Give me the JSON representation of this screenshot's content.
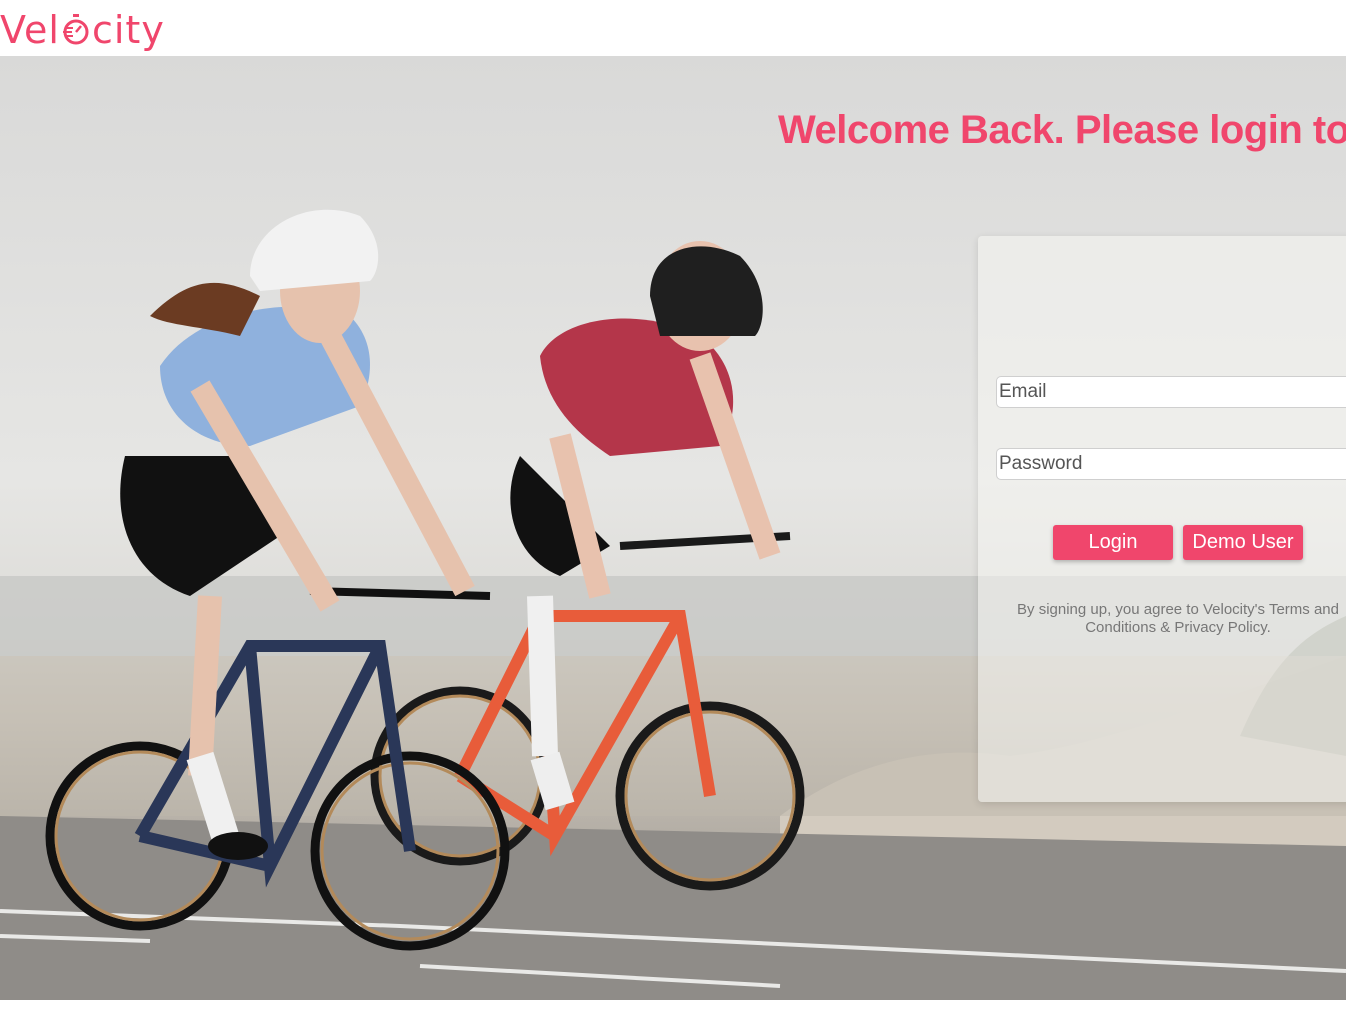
{
  "header": {
    "logo_prefix": "Vel",
    "logo_suffix": "city",
    "brand_color": "#f0466c"
  },
  "hero": {
    "headline": "Welcome Back. Please login to y"
  },
  "login": {
    "email_placeholder": "Email",
    "password_placeholder": "Password",
    "login_label": "Login",
    "demo_label": "Demo User",
    "terms_text": "By signing up, you agree to Velocity's Terms and Conditions & Privacy Policy."
  }
}
